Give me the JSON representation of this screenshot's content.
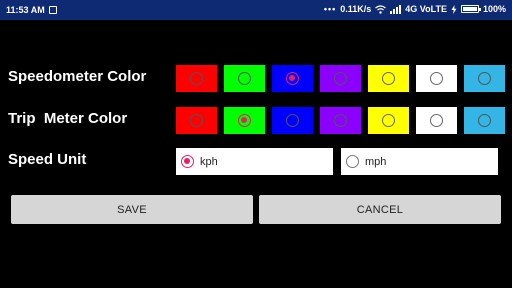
{
  "status_bar": {
    "time": "11:53 AM",
    "net_speed": "0.11K/s",
    "network": "4G VoLTE",
    "battery": "100%",
    "icons": [
      "image-icon",
      "wifi-icon",
      "signal-icon",
      "charging-icon",
      "battery-icon"
    ]
  },
  "speedometer": {
    "label": "Speedometer Color",
    "colors": [
      {
        "name": "red",
        "hex": "#ff0000",
        "selected": false
      },
      {
        "name": "green",
        "hex": "#00ff00",
        "selected": false
      },
      {
        "name": "blue",
        "hex": "#0000ff",
        "selected": true
      },
      {
        "name": "purple",
        "hex": "#8b00ff",
        "selected": false
      },
      {
        "name": "yellow",
        "hex": "#ffff00",
        "selected": false
      },
      {
        "name": "white",
        "hex": "#ffffff",
        "selected": false
      },
      {
        "name": "sky-blue",
        "hex": "#33b5e5",
        "selected": false
      }
    ]
  },
  "trip_meter": {
    "label": "Trip  Meter Color",
    "colors": [
      {
        "name": "red",
        "hex": "#ff0000",
        "selected": false
      },
      {
        "name": "green",
        "hex": "#00ff00",
        "selected": true
      },
      {
        "name": "blue",
        "hex": "#0000ff",
        "selected": false
      },
      {
        "name": "purple",
        "hex": "#8b00ff",
        "selected": false
      },
      {
        "name": "yellow",
        "hex": "#ffff00",
        "selected": false
      },
      {
        "name": "white",
        "hex": "#ffffff",
        "selected": false
      },
      {
        "name": "sky-blue",
        "hex": "#33b5e5",
        "selected": false
      }
    ]
  },
  "speed_unit": {
    "label": "Speed Unit",
    "options": [
      {
        "label": "kph",
        "selected": true
      },
      {
        "label": "mph",
        "selected": false
      }
    ]
  },
  "buttons": {
    "save": "SAVE",
    "cancel": "CANCEL"
  },
  "colors": {
    "status_bar_bg": "#0d2a73",
    "accent": "#e91e63",
    "button_bg": "#d6d6d6"
  }
}
